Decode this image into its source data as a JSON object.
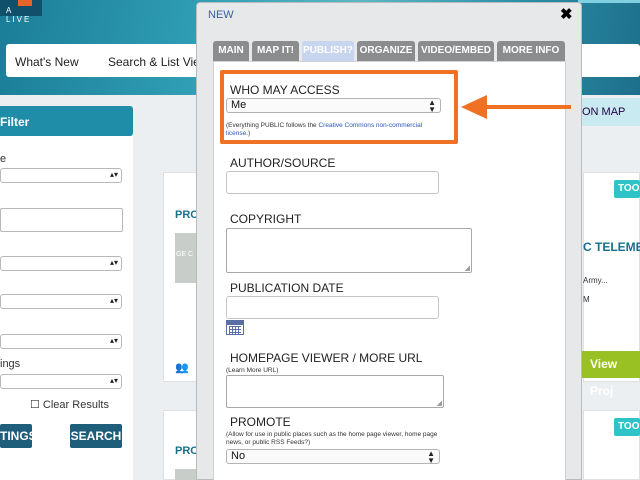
{
  "background": {
    "logo_text": "A LIVE",
    "nav": [
      "What's New",
      "Search & List View"
    ],
    "filter_label": "Filter",
    "filter_field_labels": [
      "e",
      "ings"
    ],
    "clear_results_label": "Clear Results",
    "settings_button": "TINGS",
    "search_button": "SEARCH",
    "map_tab": "ON MAP",
    "project_label": "PRO",
    "tools_label": "TOOL",
    "card_text": [
      "C TELEMET",
      "Army...",
      "M"
    ],
    "thumb_caption": "GE C",
    "view_project_label": "View Proj"
  },
  "modal": {
    "title": "NEW",
    "close_glyph": "✖",
    "tabs": [
      {
        "label": "MAIN",
        "active": false
      },
      {
        "label": "MAP IT!",
        "active": false
      },
      {
        "label": "PUBLISH?",
        "active": true
      },
      {
        "label": "ORGANIZE",
        "active": false
      },
      {
        "label": "VIDEO/EMBED",
        "active": false
      },
      {
        "label": "MORE INFO",
        "active": false
      }
    ],
    "who_may_access": {
      "label": "WHO MAY ACCESS",
      "value": "Me",
      "note_before": "(Everything PUBLIC follows the ",
      "note_link": "Creative Commons non-commercial license.",
      "note_after": ")"
    },
    "author_source": {
      "label": "AUTHOR/SOURCE",
      "value": ""
    },
    "copyright": {
      "label": "COPYRIGHT",
      "value": ""
    },
    "publication_date": {
      "label": "PUBLICATION DATE",
      "value": "",
      "icon": "calendar-icon"
    },
    "homepage_viewer": {
      "label": "HOMEPAGE VIEWER / MORE URL",
      "note": "(Learn More URL)",
      "value": ""
    },
    "promote": {
      "label": "PROMOTE",
      "note": "(Allow for use in public places such as the home page viewer, home page news, or public RSS Feeds?)",
      "value": "No"
    }
  },
  "annotation": {
    "highlight_color": "#f07024"
  }
}
